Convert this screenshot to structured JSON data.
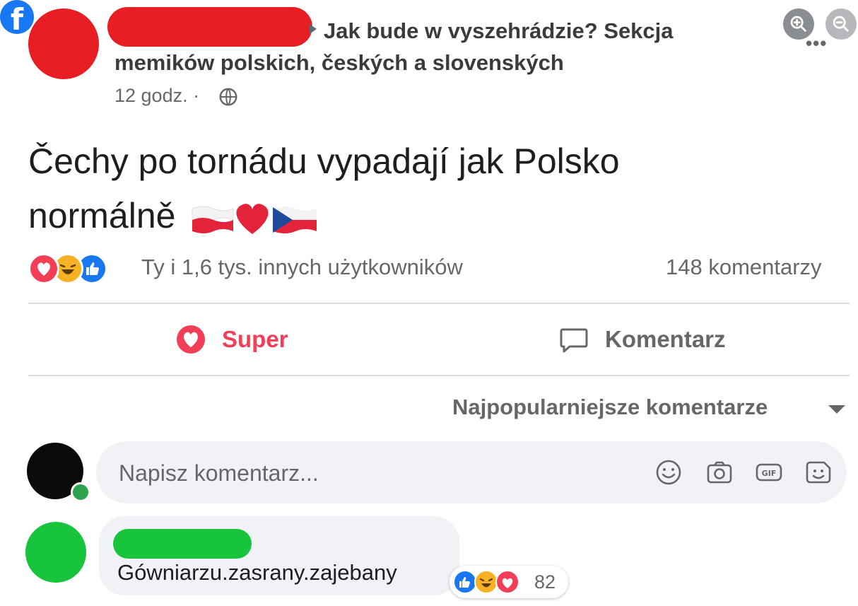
{
  "header": {
    "group_line1": "Jak bude w vyszehrádzie? Sekcja",
    "group_line2": "memików polskich, českých a slovenských",
    "time": "12 godz. ·",
    "more_label": "•••"
  },
  "post": {
    "line1": "Čechy po tornádu vypadají jak Polsko",
    "line2": "normálně"
  },
  "reactions": {
    "summary": "Ty i 1,6 tys. innych użytkowników",
    "comments": "148 komentarzy"
  },
  "actions": {
    "react_label": "Super",
    "comment_label": "Komentarz"
  },
  "sort": {
    "label": "Najpopularniejsze komentarze"
  },
  "composer": {
    "placeholder": "Napisz komentarz..."
  },
  "comment": {
    "text": "Gówniarzu.zasrany.zajebany",
    "reaction_count": "82"
  },
  "colors": {
    "facebook_blue": "#1877f2",
    "love_red": "#f33e58",
    "redaction_red": "#e81e25",
    "redaction_green": "#17c43b"
  }
}
